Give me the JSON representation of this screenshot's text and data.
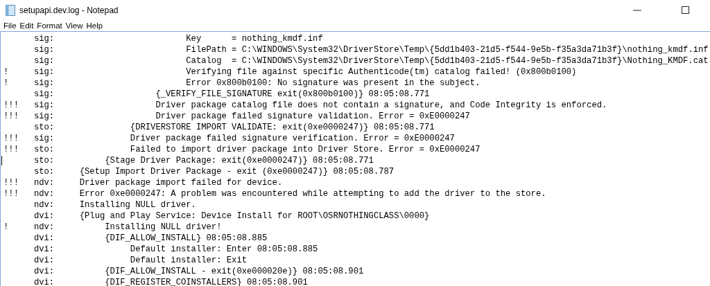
{
  "window": {
    "title": "setupapi.dev.log - Notepad"
  },
  "menu": [
    "File",
    "Edit",
    "Format",
    "View",
    "Help"
  ],
  "lines": [
    {
      "source": "sig:",
      "message": "                          Key      = nothing_kmdf.inf"
    },
    {
      "source": "sig:",
      "message": "                          FilePath = C:\\WINDOWS\\System32\\DriverStore\\Temp\\{5dd1b403-21d5-f544-9e5b-f35a3da71b3f}\\nothing_kmdf.inf"
    },
    {
      "source": "sig:",
      "message": "                          Catalog  = C:\\WINDOWS\\System32\\DriverStore\\Temp\\{5dd1b403-21d5-f544-9e5b-f35a3da71b3f}\\Nothing_KMDF.cat"
    },
    {
      "marker": "!",
      "source": "sig:",
      "message": "                          Verifying file against specific Authenticode(tm) catalog failed! (0x800b0100)"
    },
    {
      "marker": "!",
      "source": "sig:",
      "message": "                          Error 0x800b0100: No signature was present in the subject."
    },
    {
      "source": "sig:",
      "message": "                    {_VERIFY_FILE_SIGNATURE exit(0x800b0100)} 08:05:08.771"
    },
    {
      "marker": "!!!",
      "source": "sig:",
      "message": "                    Driver package catalog file does not contain a signature, and Code Integrity is enforced."
    },
    {
      "marker": "!!!",
      "source": "sig:",
      "message": "                    Driver package failed signature validation. Error = 0xE0000247"
    },
    {
      "source": "sto:",
      "message": "               {DRIVERSTORE IMPORT VALIDATE: exit(0xe0000247)} 08:05:08.771"
    },
    {
      "marker": "!!!",
      "source": "sig:",
      "message": "               Driver package failed signature verification. Error = 0xE0000247"
    },
    {
      "marker": "!!!",
      "source": "sto:",
      "message": "               Failed to import driver package into Driver Store. Error = 0xE0000247"
    },
    {
      "source": "sto:",
      "message": "          {Stage Driver Package: exit(0xe0000247)} 08:05:08.771",
      "cursor": true
    },
    {
      "source": "sto:",
      "message": "     {Setup Import Driver Package - exit (0xe0000247)} 08:05:08.787"
    },
    {
      "marker": "!!!",
      "source": "ndv:",
      "message": "     Driver package import failed for device."
    },
    {
      "marker": "!!!",
      "source": "ndv:",
      "message": "     Error 0xe0000247: A problem was encountered while attempting to add the driver to the store."
    },
    {
      "source": "ndv:",
      "message": "     Installing NULL driver."
    },
    {
      "source": "dvi:",
      "message": "     {Plug and Play Service: Device Install for ROOT\\OSRNOTHINGCLASS\\0000}"
    },
    {
      "marker": "!",
      "source": "ndv:",
      "message": "          Installing NULL driver!"
    },
    {
      "source": "dvi:",
      "message": "          {DIF_ALLOW_INSTALL} 08:05:08.885"
    },
    {
      "source": "dvi:",
      "message": "               Default installer: Enter 08:05:08.885"
    },
    {
      "source": "dvi:",
      "message": "               Default installer: Exit"
    },
    {
      "source": "dvi:",
      "message": "          {DIF_ALLOW_INSTALL - exit(0xe000020e)} 08:05:08.901"
    },
    {
      "source": "dvi:",
      "message": "          {DIF_REGISTER_COINSTALLERS} 08:05:08.901"
    }
  ]
}
